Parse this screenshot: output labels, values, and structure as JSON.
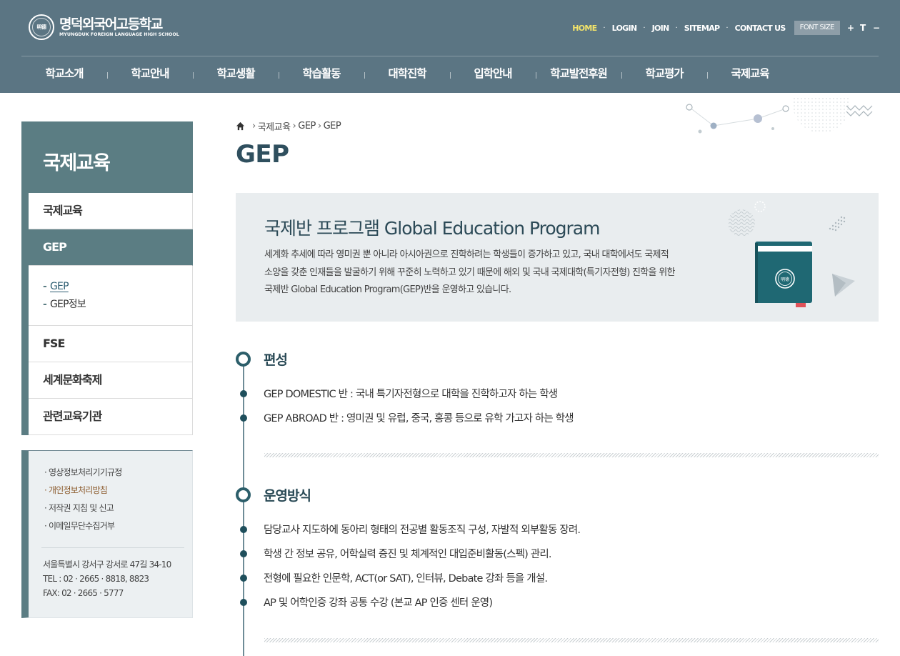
{
  "header": {
    "logo_ko": "명덕외국어고등학교",
    "logo_en": "MYUNGDUK FOREIGN LANGUAGE HIGH SCHOOL",
    "util_links": [
      "HOME",
      "LOGIN",
      "JOIN",
      "SITEMAP",
      "CONTACT US"
    ],
    "font_size_label": "FONT SIZE",
    "font_plus": "+",
    "font_reset": "T",
    "font_minus": "−",
    "gnb": [
      "학교소개",
      "학교안내",
      "학교생활",
      "학습활동",
      "대학진학",
      "입학안내",
      "학교발전후원",
      "학교평가",
      "국제교육"
    ]
  },
  "sidebar": {
    "title": "국제교육",
    "items": [
      {
        "label": "국제교육"
      },
      {
        "label": "GEP"
      },
      {
        "sub": [
          "GEP",
          "GEP정보"
        ]
      },
      {
        "label": "FSE"
      },
      {
        "label": "세계문화축제"
      },
      {
        "label": "관련교육기관"
      }
    ],
    "links": [
      "· 영상정보처리기기규정",
      "· 개인정보처리방침",
      "· 저작권 지침 및 신고",
      "· 이메일무단수집거부"
    ],
    "address": "서울특별시 강서구 강서로 47길 34-10",
    "tel": "TEL : 02 · 2665 · 8818, 8823",
    "fax": "FAX: 02 · 2665 · 5777"
  },
  "breadcrumb": [
    "국제교육",
    "GEP",
    "GEP"
  ],
  "page_title": "GEP",
  "intro": {
    "title": "국제반 프로그램 Global Education Program",
    "desc": [
      "세계화 추세에 따라 영미권 뿐 아니라 아시아권으로 진학하려는 학생들이 증가하고 있고, 국내 대학에서도 국제적",
      "소양을 갖춘 인재들을 발굴하기 위해 꾸준히 노력하고 있기 때문에 해외 및 국내 국제대학(특기자전형) 진학을 위한",
      "국제반 Global Education Program(GEP)반을 운영하고 있습니다."
    ]
  },
  "sections": [
    {
      "title": "편성",
      "items": [
        "GEP DOMESTIC 반 : 국내 특기자전형으로 대학을 진학하고자 하는 학생",
        "GEP ABROAD 반 : 영미권 및 유럽, 중국, 홍콩 등으로 유학 가고자 하는 학생"
      ]
    },
    {
      "title": "운영방식",
      "items": [
        "담당교사 지도하에 동아리 형태의 전공별 활동조직 구성, 자발적 외부활동 장려.",
        "학생 간 정보 공유, 어학실력 증진 및 체계적인 대입준비활동(스펙) 관리.",
        "전형에 필요한 인문학, ACT(or SAT), 인터뷰, Debate 강좌 등을 개설.",
        "AP 및 어학인증 강좌 공통 수강 (본교 AP 인증 센터 운영)"
      ]
    }
  ],
  "colors": {
    "header_bg": "#5b7583",
    "accent": "#5b7d83",
    "home_highlight": "#f2e36a",
    "book": "#1f6873"
  }
}
